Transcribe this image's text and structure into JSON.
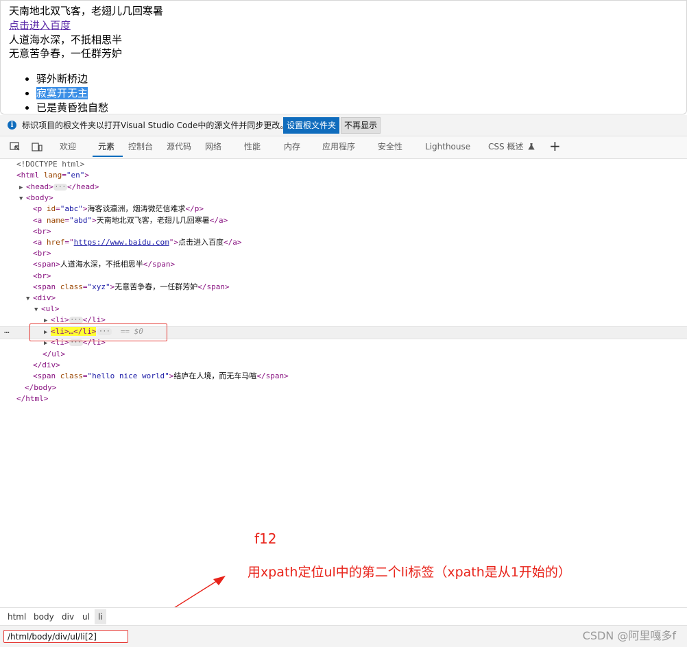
{
  "page": {
    "line1": "天南地北双飞客，老翅儿几回寒暑",
    "link": "点击进入百度",
    "line3": "人道海水深，不抵相思半",
    "line4": "无意苦争春，一任群芳妒",
    "list": [
      "驿外断桥边",
      "寂寞开无主",
      "已是黄昏独自愁"
    ]
  },
  "infobar": {
    "icon": "info-icon",
    "text": "标识项目的根文件夹以打开Visual Studio Code中的源文件并同步更改。",
    "primary_button": "设置根文件夹",
    "secondary_button": "不再显示"
  },
  "toolbar": {
    "tabs": [
      "欢迎",
      "元素",
      "控制台",
      "源代码",
      "网络",
      "性能",
      "内存",
      "应用程序",
      "安全性",
      "Lighthouse",
      "CSS 概述"
    ],
    "active_tab": "元素",
    "plus": "+"
  },
  "dom": {
    "doctype": "<!DOCTYPE html>",
    "html_open": "<html",
    "lang_attr": "lang",
    "lang_val": "\"en\"",
    "head": "<head>",
    "head_close": "</head>",
    "body_open": "<body>",
    "p_tag": "<p",
    "p_attr": "id",
    "p_val": "\"abc\"",
    "p_text": "海客谈瀛洲，烟涛微茫信难求",
    "p_close": "</p>",
    "a1_tag": "<a",
    "a1_attr": "name",
    "a1_val": "\"abd\"",
    "a1_text": "天南地北双飞客，老翅儿几回寒暑",
    "a_close": "</a>",
    "br": "<br>",
    "a2_tag": "<a",
    "a2_attr": "href",
    "a2_val": "https://www.baidu.com",
    "a2_text": "点击进入百度",
    "span1_tag": "<span>",
    "span1_text": "人道海水深，不抵相思半",
    "span_close": "</span>",
    "span2_tag": "<span",
    "span2_attr": "class",
    "span2_val": "\"xyz\"",
    "span2_text": "无意苦争春，一任群芳妒",
    "div_open": "<div>",
    "ul_open": "<ul>",
    "li_open": "<li>",
    "li_close": "</li>",
    "li_selected": "<li>…</li>",
    "eq0": "== $0",
    "ul_close": "</ul>",
    "div_close": "</div>",
    "span3_tag": "<span",
    "span3_attr": "class",
    "span3_val": "\"hello nice world\"",
    "span3_text": "结庐在人境，而无车马喧",
    "body_close": "</body>",
    "html_close": "</html>",
    "gt": ">",
    "ellipsis": "···"
  },
  "annotations": {
    "f12": "f12",
    "note": "用xpath定位ul中的第二个li标签（xpath是从1开始的）"
  },
  "breadcrumbs": [
    "html",
    "body",
    "div",
    "ul",
    "li"
  ],
  "xpath": "/html/body/div/ul/li[2]",
  "watermark": "CSDN @阿里嘎多f",
  "colors": {
    "accent": "#0f6cbd",
    "annotation_red": "#e8231a",
    "selection_yellow": "#ffff33",
    "tag_purple": "#881280"
  }
}
